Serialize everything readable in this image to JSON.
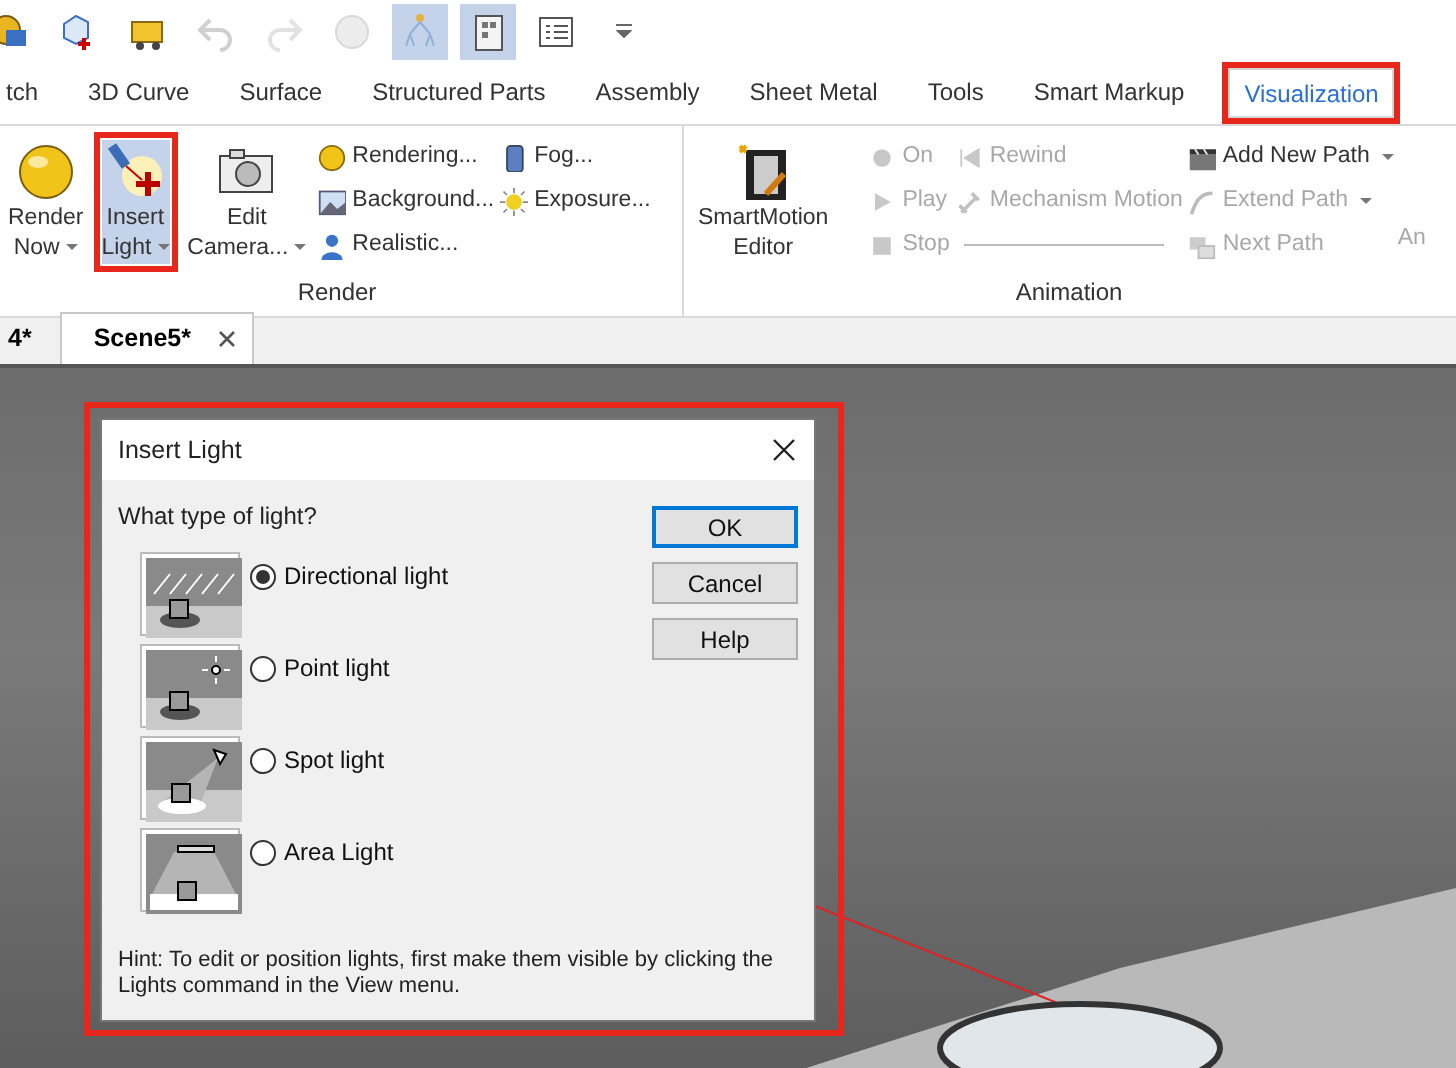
{
  "quick_access": [
    {
      "kind": "part",
      "pressed": false,
      "disabled": false
    },
    {
      "kind": "cube",
      "pressed": false,
      "disabled": false
    },
    {
      "kind": "cart",
      "pressed": false,
      "disabled": false
    },
    {
      "kind": "undo",
      "pressed": false,
      "disabled": true
    },
    {
      "kind": "redo",
      "pressed": false,
      "disabled": true
    },
    {
      "kind": "sphere",
      "pressed": false,
      "disabled": true
    },
    {
      "kind": "tree",
      "pressed": true,
      "disabled": false
    },
    {
      "kind": "panel",
      "pressed": true,
      "disabled": false
    },
    {
      "kind": "list",
      "pressed": false,
      "disabled": false
    },
    {
      "kind": "caret",
      "pressed": false,
      "disabled": false
    }
  ],
  "ribbon_tabs": [
    {
      "label": "tch",
      "selected": false,
      "annotated": false
    },
    {
      "label": "3D Curve",
      "selected": false,
      "annotated": false
    },
    {
      "label": "Surface",
      "selected": false,
      "annotated": false
    },
    {
      "label": "Structured Parts",
      "selected": false,
      "annotated": false
    },
    {
      "label": "Assembly",
      "selected": false,
      "annotated": false
    },
    {
      "label": "Sheet Metal",
      "selected": false,
      "annotated": false
    },
    {
      "label": "Tools",
      "selected": false,
      "annotated": false
    },
    {
      "label": "Smart Markup",
      "selected": false,
      "annotated": false
    },
    {
      "label": "Visualization",
      "selected": true,
      "annotated": true
    }
  ],
  "ribbon_groups": [
    {
      "label": "Render",
      "large_buttons": [
        {
          "lines": [
            "Render",
            "Now"
          ],
          "kind": "sphere",
          "dropdown": true,
          "selected": false,
          "annotated": false
        },
        {
          "lines": [
            "Insert",
            "Light"
          ],
          "kind": "light",
          "dropdown": true,
          "selected": true,
          "annotated": true
        },
        {
          "lines": [
            "Edit",
            "Camera..."
          ],
          "kind": "camera",
          "dropdown": true,
          "selected": false,
          "annotated": false
        }
      ],
      "small_columns": [
        [
          {
            "label": "Rendering...",
            "kind": "ball",
            "dropdown": false,
            "disabled": false
          },
          {
            "label": "Background...",
            "kind": "picture",
            "dropdown": false,
            "disabled": false
          },
          {
            "label": "Realistic...",
            "kind": "person",
            "dropdown": false,
            "disabled": false
          }
        ],
        [
          {
            "label": "Fog...",
            "kind": "cylinder",
            "dropdown": false,
            "disabled": false
          },
          {
            "label": "Exposure...",
            "kind": "sun",
            "dropdown": false,
            "disabled": false
          }
        ]
      ]
    },
    {
      "label": "Animation",
      "large_buttons": [
        {
          "lines": [
            "SmartMotion",
            "Editor"
          ],
          "kind": "film",
          "dropdown": false,
          "selected": false,
          "annotated": false
        }
      ],
      "small_columns": [
        [
          {
            "label": "On",
            "kind": "dot",
            "dropdown": false,
            "disabled": true
          },
          {
            "label": "Play",
            "kind": "play",
            "dropdown": false,
            "disabled": true
          },
          {
            "label": "Stop",
            "kind": "stop",
            "dropdown": false,
            "disabled": true
          }
        ],
        [
          {
            "label": "Rewind",
            "kind": "rewind",
            "dropdown": false,
            "disabled": true
          },
          {
            "label": "Mechanism Motion",
            "kind": "wrench",
            "dropdown": false,
            "disabled": true
          }
        ],
        [
          {
            "label": "Add New Path",
            "kind": "clapper",
            "dropdown": true,
            "disabled": false
          },
          {
            "label": "Extend Path",
            "kind": "curve",
            "dropdown": true,
            "disabled": true
          },
          {
            "label": "Next Path",
            "kind": "path",
            "dropdown": false,
            "disabled": true
          }
        ]
      ],
      "trailing_buttons": [
        {
          "label": "An",
          "disabled": true
        }
      ]
    }
  ],
  "document_tabs": [
    {
      "label": "4*",
      "selected": false,
      "closable": false
    },
    {
      "label": "Scene5*",
      "selected": true,
      "closable": true
    }
  ],
  "dialog": {
    "title": "Insert Light",
    "annotated": true,
    "prompt": "What type of light?",
    "options": [
      {
        "kind": "directional",
        "label": "Directional light",
        "selected": true
      },
      {
        "kind": "point",
        "label": "Point light",
        "selected": false
      },
      {
        "kind": "spot",
        "label": "Spot light",
        "selected": false
      },
      {
        "kind": "area",
        "label": "Area Light",
        "selected": false
      }
    ],
    "buttons": [
      {
        "label": "OK",
        "default": true
      },
      {
        "label": "Cancel",
        "default": false
      },
      {
        "label": "Help",
        "default": false
      }
    ],
    "hint": "Hint: To edit or position lights, first make them visible by clicking the Lights command in the View menu."
  }
}
